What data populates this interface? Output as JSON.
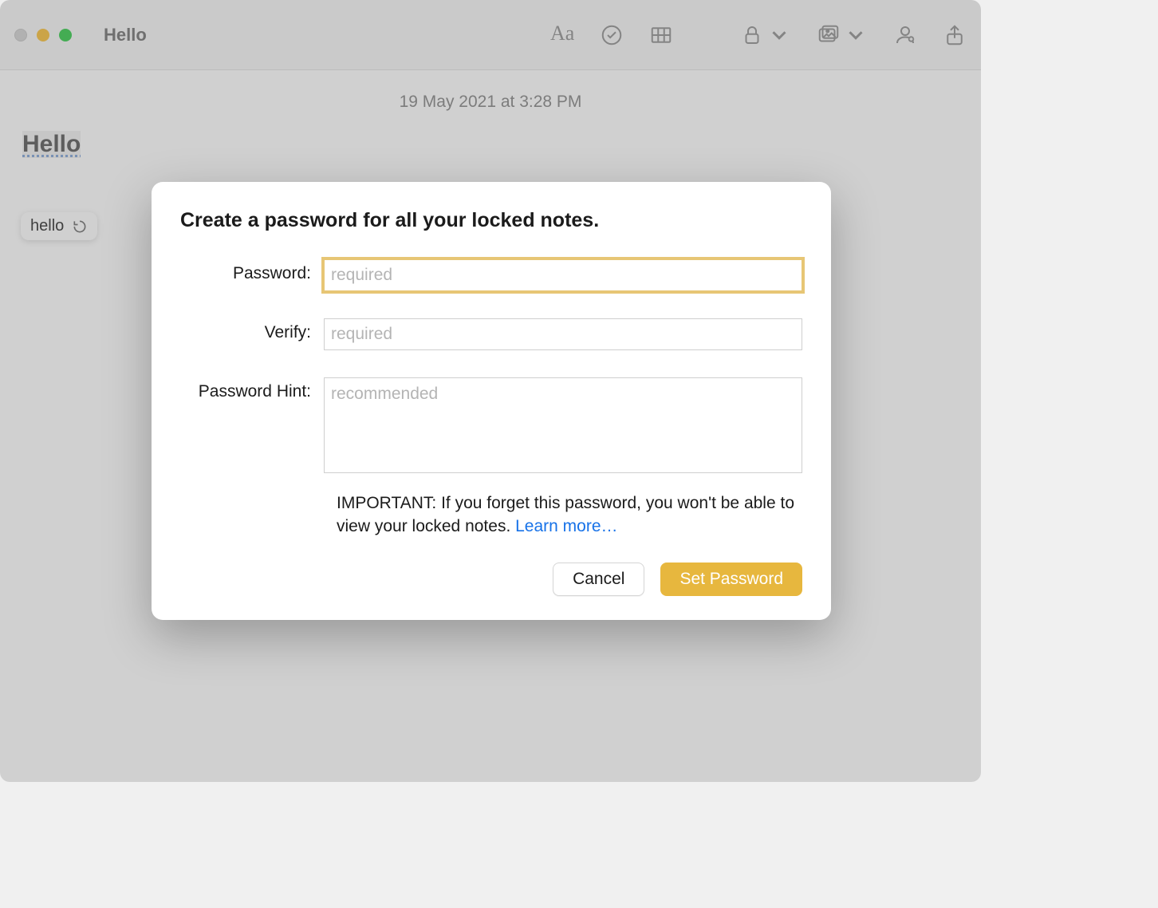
{
  "window": {
    "title": "Hello"
  },
  "note": {
    "date": "19 May 2021 at 3:28 PM",
    "heading": "Hello",
    "autocorrect_suggestion": "hello"
  },
  "toolbar": {
    "format_icon": "Aa"
  },
  "modal": {
    "title": "Create a password for all your locked notes.",
    "password_label": "Password:",
    "password_placeholder": "required",
    "verify_label": "Verify:",
    "verify_placeholder": "required",
    "hint_label": "Password Hint:",
    "hint_placeholder": "recommended",
    "important_text_prefix": "IMPORTANT: If you forget this password, you won't be able to view your locked notes. ",
    "learn_more_label": "Learn more…",
    "cancel_label": "Cancel",
    "confirm_label": "Set Password"
  }
}
